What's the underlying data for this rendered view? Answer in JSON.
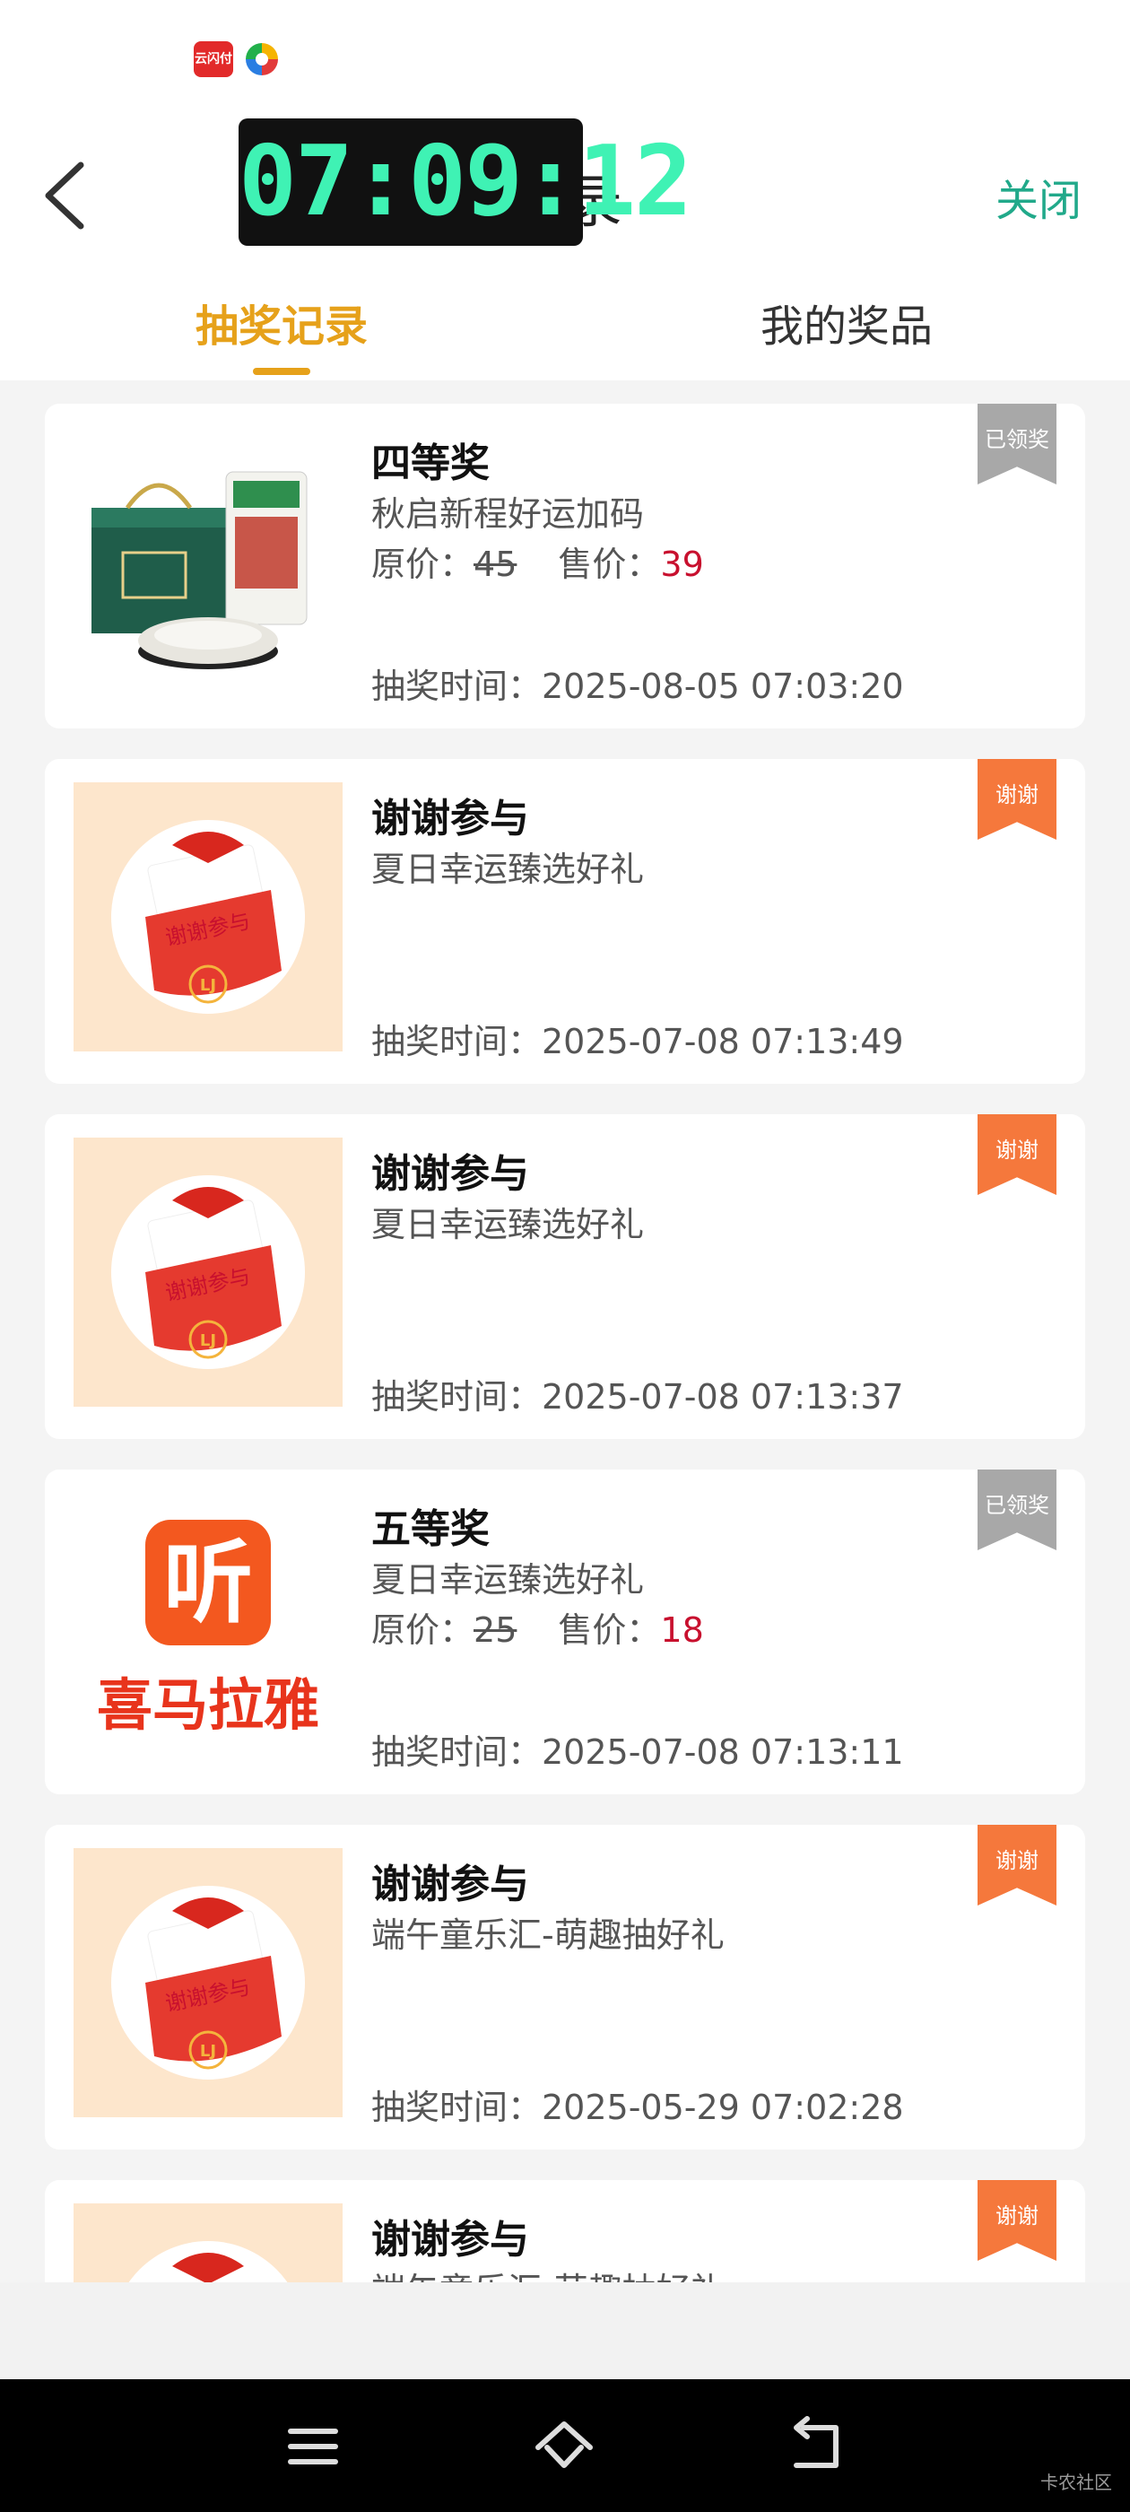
{
  "header": {
    "title": "记录",
    "close_label": "关闭",
    "clock": "07:09:12"
  },
  "tabs": [
    {
      "label": "抽奖记录",
      "active": true
    },
    {
      "label": "我的奖品",
      "active": false
    }
  ],
  "records": [
    {
      "prize": "四等奖",
      "activity": "秋启新程好运加码",
      "orig_label": "原价：",
      "orig_price": "45",
      "sale_label": "售价：",
      "sale_price": "39",
      "time": "抽奖时间：2025-08-05 07:03:20",
      "badge": "已领奖",
      "thumb": "flour-giftbox"
    },
    {
      "prize": "谢谢参与",
      "activity": "夏日幸运臻选好礼",
      "time": "抽奖时间：2025-07-08 07:13:49",
      "badge": "谢谢",
      "thumb": "thanks-envelope"
    },
    {
      "prize": "谢谢参与",
      "activity": "夏日幸运臻选好礼",
      "time": "抽奖时间：2025-07-08 07:13:37",
      "badge": "谢谢",
      "thumb": "thanks-envelope"
    },
    {
      "prize": "五等奖",
      "activity": "夏日幸运臻选好礼",
      "orig_label": "原价：",
      "orig_price": "25",
      "sale_label": "售价：",
      "sale_price": "18",
      "time": "抽奖时间：2025-07-08 07:13:11",
      "badge": "已领奖",
      "thumb": "ximalaya-logo",
      "thumb_icon": "听",
      "thumb_text": "喜马拉雅"
    },
    {
      "prize": "谢谢参与",
      "activity": "端午童乐汇-萌趣抽好礼",
      "time": "抽奖时间：2025-05-29 07:02:28",
      "badge": "谢谢",
      "thumb": "thanks-envelope"
    },
    {
      "prize": "谢谢参与",
      "activity": "端午童乐汇-萌趣抽好礼",
      "badge": "谢谢",
      "thumb": "thanks-envelope"
    }
  ],
  "envelope_text": "谢谢参与",
  "colors": {
    "accent": "#e6a11a",
    "close": "#21a98a",
    "sale_price": "#c8102e",
    "badge_claimed": "#a8a8a8",
    "badge_thanks": "#f5783c"
  },
  "nav": [
    "menu-icon",
    "home-icon",
    "back-icon"
  ],
  "watermark": "卡农社区"
}
